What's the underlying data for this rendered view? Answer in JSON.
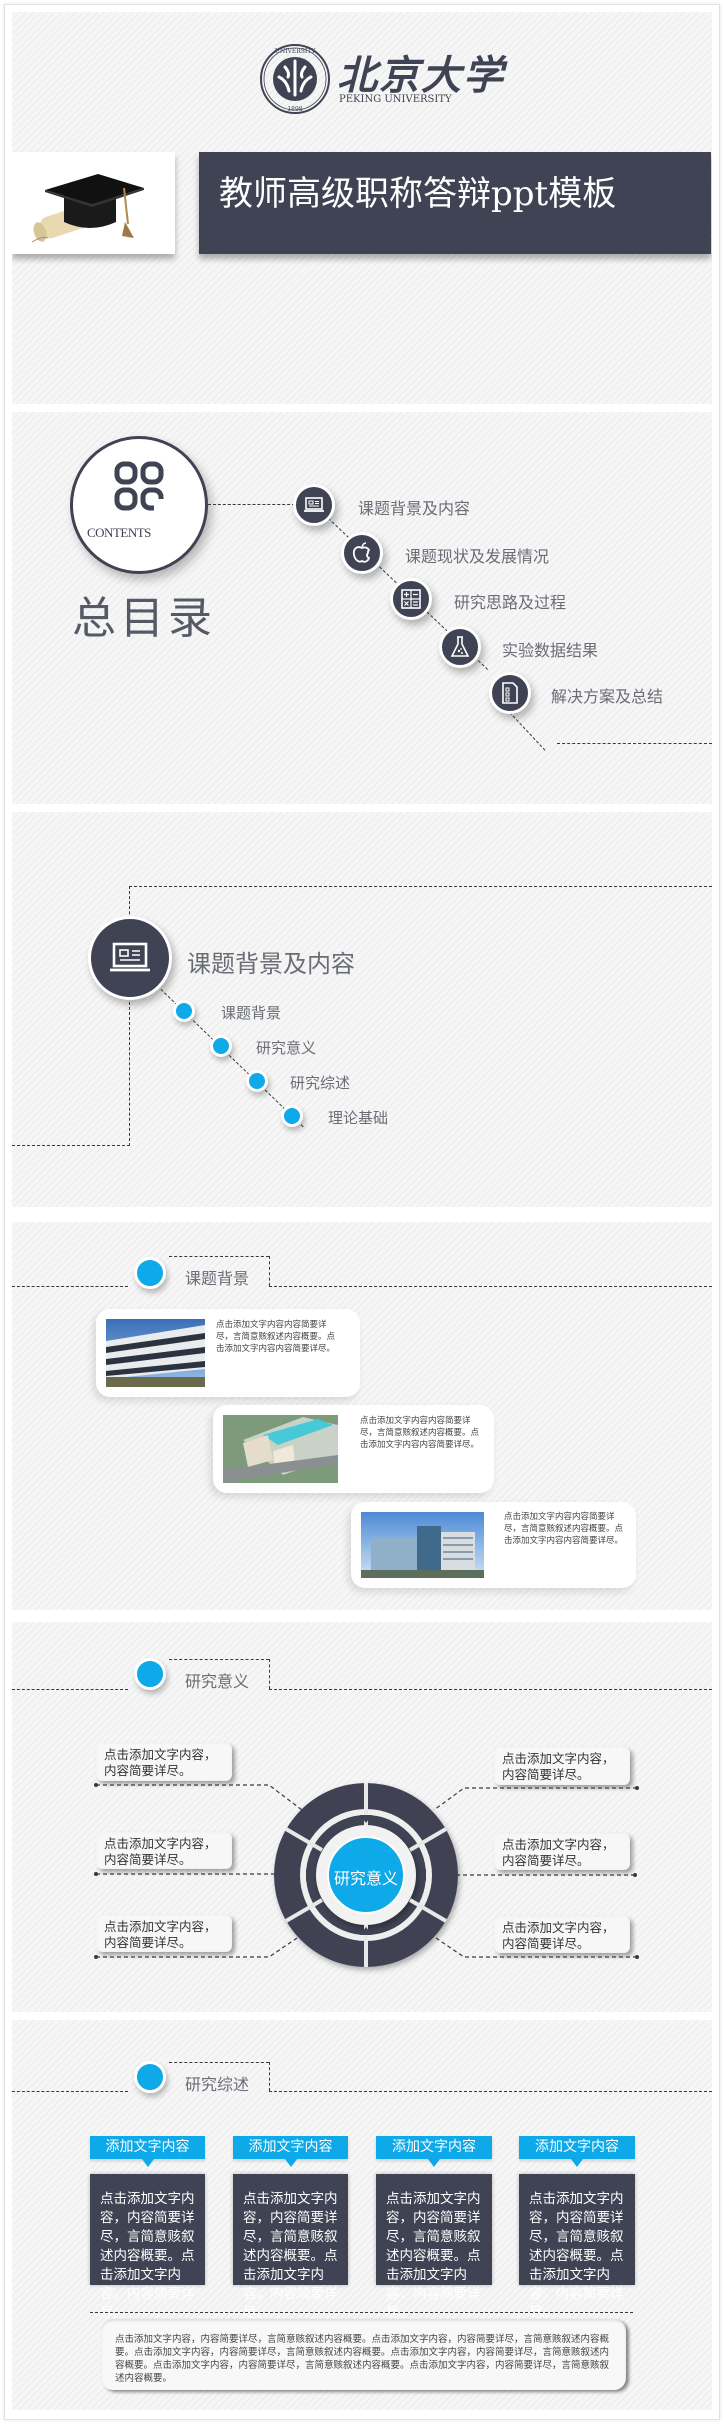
{
  "header": {
    "university_cn": "北京大学",
    "university_en": "PEKING UNIVERSITY",
    "seal_ring_text": "PEKING UNIVERSITY",
    "seal_year": "1898",
    "title": "教师高级职称答辩ppt模板",
    "cap_image": "graduation-cap-and-diploma"
  },
  "toc": {
    "badge_label": "CONTENTS",
    "heading": "总目录",
    "items": [
      {
        "icon": "laptop-icon",
        "label": "课题背景及内容"
      },
      {
        "icon": "apple-icon",
        "label": "课题现状及发展情况"
      },
      {
        "icon": "calculator-icon",
        "label": "研究思路及过程"
      },
      {
        "icon": "flask-icon",
        "label": "实验数据结果"
      },
      {
        "icon": "checklist-document-icon",
        "label": "解决方案及总结"
      }
    ]
  },
  "chapter1": {
    "icon": "laptop-icon",
    "title": "课题背景及内容",
    "subitems": [
      "课题背景",
      "研究意义",
      "研究综述",
      "理论基础"
    ]
  },
  "background": {
    "heading": "课题背景",
    "cards": [
      {
        "image": "office-building-photo",
        "text": "点击添加文字内容内容简要详尽，言简意赅叙述内容概要。点击添加文字内容内容简要详尽。"
      },
      {
        "image": "campus-aerial-rendering",
        "text": "点击添加文字内容内容简要详尽，言简意赅叙述内容概要。点击添加文字内容内容简要详尽。"
      },
      {
        "image": "modern-building-rendering",
        "text": "点击添加文字内容内容简要详尽，言简意赅叙述内容概要。点击添加文字内容内容简要详尽。"
      }
    ]
  },
  "significance": {
    "heading": "研究意义",
    "center_label": "研究意义",
    "left_notes": [
      "点击添加文字内容，内容简要详尽。",
      "点击添加文字内容，内容简要详尽。",
      "点击添加文字内容，内容简要详尽。"
    ],
    "right_notes": [
      "点击添加文字内容，内容简要详尽。",
      "点击添加文字内容，内容简要详尽。",
      "点击添加文字内容，内容简要详尽。"
    ]
  },
  "review": {
    "heading": "研究综述",
    "columns": [
      {
        "title": "添加文字内容",
        "body": "点击添加文字内容，内容简要详尽，言简意赅叙述内容概要。点击添加文字内容，内容简要详尽。"
      },
      {
        "title": "添加文字内容",
        "body": "点击添加文字内容，内容简要详尽，言简意赅叙述内容概要。点击添加文字内容，内容简要详尽。"
      },
      {
        "title": "添加文字内容",
        "body": "点击添加文字内容，内容简要详尽，言简意赅叙述内容概要。点击添加文字内容，内容简要详尽。"
      },
      {
        "title": "添加文字内容",
        "body": "点击添加文字内容，内容简要详尽，言简意赅叙述内容概要。点击添加文字内容，内容简要详尽。"
      }
    ],
    "summary": "点击添加文字内容，内容简要详尽，言简意赅叙述内容概要。点击添加文字内容，内容简要详尽，言简意赅叙述内容概要。点击添加文字内容，内容简要详尽，言简意赅叙述内容概要。点击添加文字内容，内容简要详尽，言简意赅叙述内容概要。点击添加文字内容，内容简要详尽，言简意赅叙述内容概要。点击添加文字内容，内容简要详尽，言简意赅叙述内容概要。"
  },
  "colors": {
    "dark": "#3f4353",
    "accent_blue": "#0ea9e8",
    "text_gray": "#6a6d76"
  }
}
